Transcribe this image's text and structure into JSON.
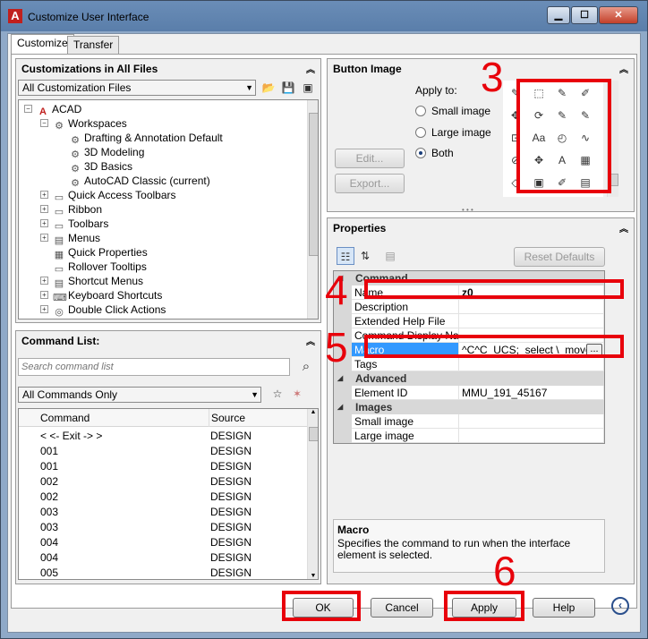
{
  "window": {
    "title": "Customize User Interface"
  },
  "tabs": [
    "Customize",
    "Transfer"
  ],
  "customizations_pane": {
    "title": "Customizations in All Files",
    "filter": "All Customization Files",
    "tree": [
      {
        "label": "ACAD",
        "level": 0,
        "expander": "−",
        "icon": "acad-icon"
      },
      {
        "label": "Workspaces",
        "level": 1,
        "expander": "−",
        "icon": "workspace-icon"
      },
      {
        "label": "Drafting & Annotation Default",
        "level": 2,
        "expander": "",
        "icon": "gear-icon"
      },
      {
        "label": "3D Modeling",
        "level": 2,
        "expander": "",
        "icon": "gear-icon"
      },
      {
        "label": "3D Basics",
        "level": 2,
        "expander": "",
        "icon": "gear-icon"
      },
      {
        "label": "AutoCAD Classic (current)",
        "level": 2,
        "expander": "",
        "icon": "gear-icon"
      },
      {
        "label": "Quick Access Toolbars",
        "level": 1,
        "expander": "+",
        "icon": "toolbar-icon"
      },
      {
        "label": "Ribbon",
        "level": 1,
        "expander": "+",
        "icon": "ribbon-icon"
      },
      {
        "label": "Toolbars",
        "level": 1,
        "expander": "+",
        "icon": "toolbar-icon"
      },
      {
        "label": "Menus",
        "level": 1,
        "expander": "+",
        "icon": "menu-icon"
      },
      {
        "label": "Quick Properties",
        "level": 1,
        "expander": "",
        "icon": "properties-icon"
      },
      {
        "label": "Rollover Tooltips",
        "level": 1,
        "expander": "",
        "icon": "tooltip-icon"
      },
      {
        "label": "Shortcut Menus",
        "level": 1,
        "expander": "+",
        "icon": "shortcut-menu-icon"
      },
      {
        "label": "Keyboard Shortcuts",
        "level": 1,
        "expander": "+",
        "icon": "keyboard-icon"
      },
      {
        "label": "Double Click Actions",
        "level": 1,
        "expander": "+",
        "icon": "double-click-icon"
      }
    ]
  },
  "command_list": {
    "title": "Command List:",
    "search_placeholder": "Search command list",
    "filter": "All Commands Only",
    "columns": [
      "Command",
      "Source"
    ],
    "rows": [
      [
        "< <- Exit -> >",
        "DESIGN"
      ],
      [
        "001",
        "DESIGN"
      ],
      [
        "001",
        "DESIGN"
      ],
      [
        "002",
        "DESIGN"
      ],
      [
        "002",
        "DESIGN"
      ],
      [
        "003",
        "DESIGN"
      ],
      [
        "003",
        "DESIGN"
      ],
      [
        "004",
        "DESIGN"
      ],
      [
        "004",
        "DESIGN"
      ],
      [
        "005",
        "DESIGN"
      ]
    ]
  },
  "button_image": {
    "title": "Button Image",
    "apply_to_label": "Apply to:",
    "options": [
      "Small image",
      "Large image",
      "Both"
    ],
    "selected": "Both",
    "edit_label": "Edit...",
    "export_label": "Export..."
  },
  "properties": {
    "title": "Properties",
    "reset_label": "Reset Defaults",
    "rows": [
      {
        "type": "category",
        "label": "Command"
      },
      {
        "type": "prop",
        "label": "Name",
        "value": "z0"
      },
      {
        "type": "prop",
        "label": "Description",
        "value": ""
      },
      {
        "type": "prop",
        "label": "Extended Help File",
        "value": ""
      },
      {
        "type": "prop",
        "label": "Command Display Nam",
        "value": ""
      },
      {
        "type": "prop",
        "label": "Macro",
        "value": "^C^C_UCS;_select \\_move",
        "selected": true
      },
      {
        "type": "prop",
        "label": "Tags",
        "value": ""
      },
      {
        "type": "category",
        "label": "Advanced"
      },
      {
        "type": "prop",
        "label": "Element ID",
        "value": "MMU_191_45167"
      },
      {
        "type": "category",
        "label": "Images"
      },
      {
        "type": "prop",
        "label": "Small image",
        "value": ""
      },
      {
        "type": "prop",
        "label": "Large image",
        "value": ""
      }
    ],
    "browse_label": "...",
    "desc_title": "Macro",
    "desc_text": "Specifies the command to run when the interface element is selected."
  },
  "footer": {
    "ok": "OK",
    "cancel": "Cancel",
    "apply": "Apply",
    "help": "Help"
  },
  "annotations": [
    "3",
    "4",
    "5",
    "6"
  ],
  "colors": {
    "annotation": "#e8000b",
    "selection": "#3399ff"
  }
}
